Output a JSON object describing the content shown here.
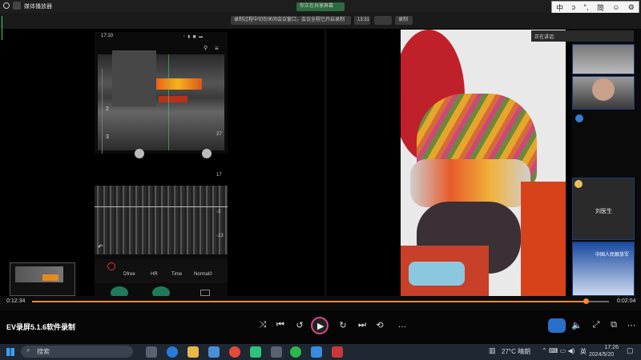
{
  "window": {
    "title": "媒体播放器"
  },
  "meeting": {
    "notice": "录制过程中切勿关闭会议窗口，会议全程已开启录制",
    "share_label": "你正在共享屏幕",
    "time": "13:31",
    "record_label": "录制"
  },
  "ime": {
    "mode": "中",
    "items": [
      "ↄ",
      "°,",
      "简",
      "☺",
      "⚙"
    ]
  },
  "phone": {
    "status_time": "17:10",
    "bpm": "bpm",
    "depth_marks": [
      "2",
      "3"
    ],
    "scale_marks": [
      "27",
      "17",
      "-3",
      "-13"
    ],
    "tools": [
      "Dfree",
      "HR",
      "Time",
      "Normal0"
    ]
  },
  "speaking": {
    "label": "正在讲话:"
  },
  "participants": {
    "named": "刘医生",
    "banner": "中国人民解放军"
  },
  "player": {
    "current": "0:12:34",
    "total": "0:02:04",
    "progress": 0.96,
    "brand": "EV录屏5.1.6软件录制"
  },
  "taskbar": {
    "search": "搜索",
    "weather": "27°C 晴朗",
    "lang": "英",
    "time": "17:26",
    "date": "2024/5/20"
  }
}
